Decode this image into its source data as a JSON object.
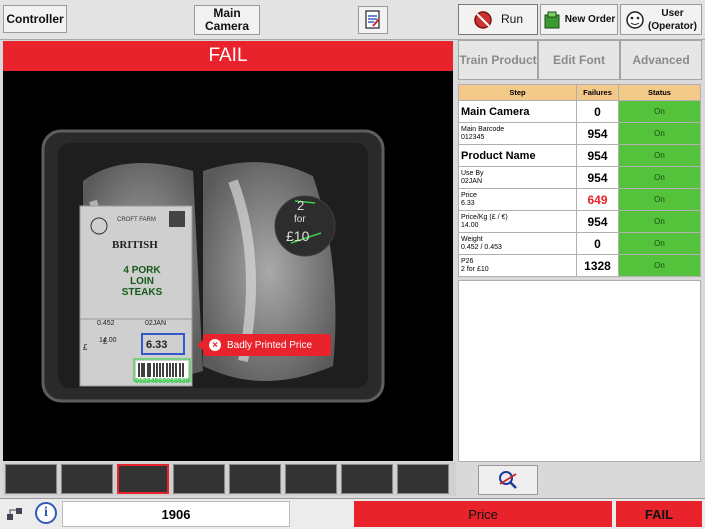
{
  "toolbar": {
    "controller_label": "Controller",
    "main_camera_label": "Main\nCamera",
    "run_label": "Run",
    "new_order_label": "New Order",
    "user_label": "User\n(Operator)"
  },
  "camera": {
    "result_text": "FAIL",
    "annotation": "Badly Printed Price",
    "label": {
      "farm": "CROFT FARM",
      "origin": "BRITISH",
      "product": "4 PORK\nLOIN\nSTEAKS",
      "kg_price": "14.00",
      "weight": "0.452",
      "use_by": "02JAN",
      "price": "6.33",
      "barcode_digits": "01234560063538",
      "pound": "£",
      "per_kg": "£"
    },
    "promo": {
      "line1": "2",
      "line2": "for",
      "line3": "£10"
    }
  },
  "tabs": {
    "train_product": "Train Product",
    "edit_font": "Edit Font",
    "advanced": "Advanced"
  },
  "steps_table": {
    "headers": [
      "Step",
      "Failures",
      "Status"
    ],
    "rows": [
      {
        "name": "Main Camera",
        "sub": "",
        "failures": "0",
        "status": "On",
        "failed": false
      },
      {
        "name": "Main Barcode",
        "sub": "012345",
        "failures": "954",
        "status": "On",
        "failed": false
      },
      {
        "name": "Product Name",
        "sub": "",
        "failures": "954",
        "status": "On",
        "failed": false
      },
      {
        "name": "Use By",
        "sub": "02JAN",
        "failures": "954",
        "status": "On",
        "failed": false
      },
      {
        "name": "Price",
        "sub": "6.33",
        "failures": "649",
        "status": "On",
        "failed": true
      },
      {
        "name": "Price/Kg (£ / €)",
        "sub": "14.00",
        "failures": "954",
        "status": "On",
        "failed": false
      },
      {
        "name": "Weight",
        "sub": "0.452 / 0.453",
        "failures": "0",
        "status": "On",
        "failed": false
      },
      {
        "name": "P26",
        "sub": "2 for £10",
        "failures": "1328",
        "status": "On",
        "failed": false
      }
    ]
  },
  "status_bar": {
    "count": "1906",
    "failed_step": "Price",
    "result": "FAIL"
  },
  "colors": {
    "fail_red": "#e8232b",
    "status_green": "#55c23b",
    "header_orange": "#f3c98a"
  }
}
